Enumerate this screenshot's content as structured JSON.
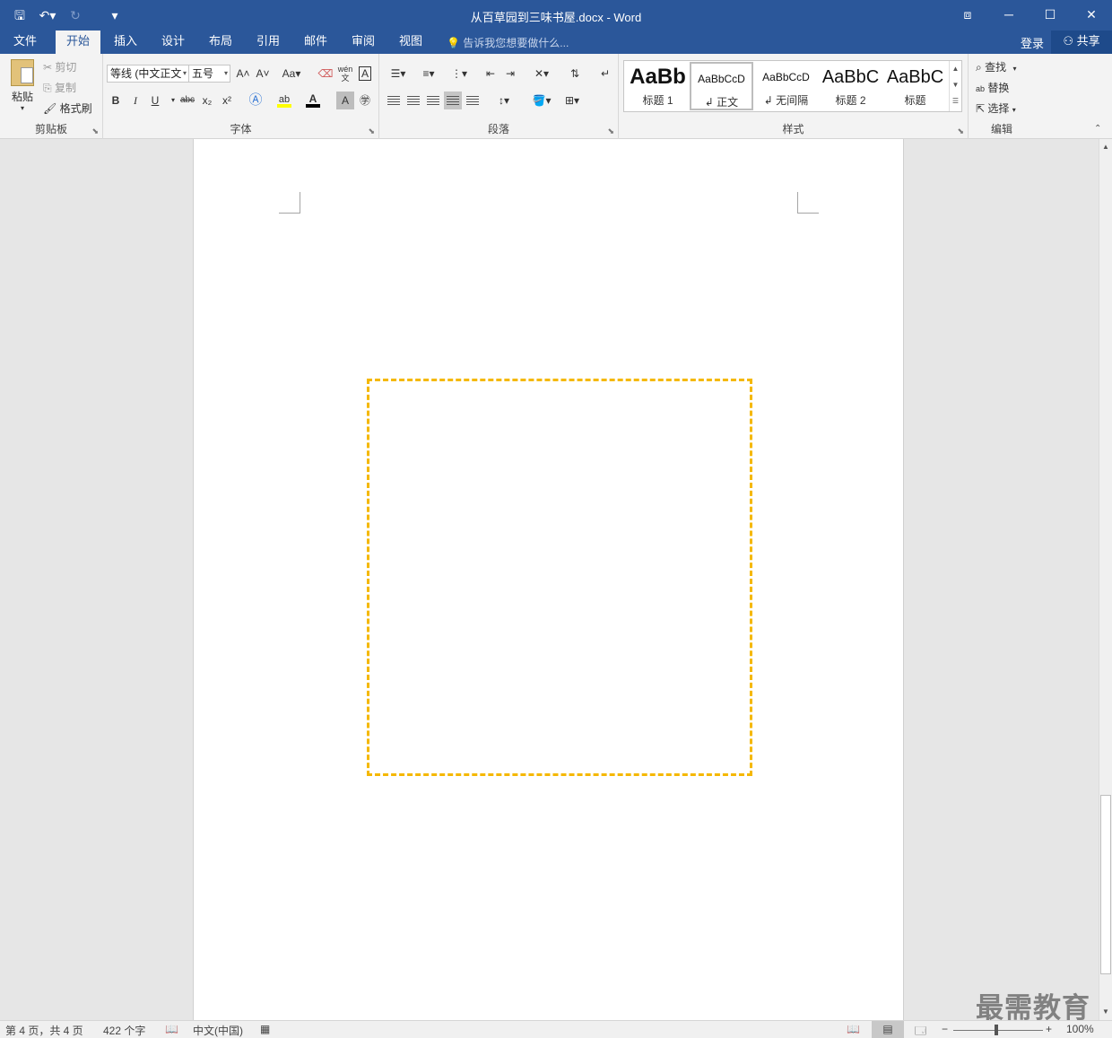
{
  "titlebar": {
    "title": "从百草园到三味书屋.docx - Word",
    "qat": {
      "save": "🖫",
      "undo": "↶▾",
      "redo": "↻",
      "customize": "▾"
    },
    "window_buttons": {
      "ribbon_options": "⧈",
      "minimize": "─",
      "maximize": "☐",
      "close": "✕"
    }
  },
  "tabs": [
    "文件",
    "开始",
    "插入",
    "设计",
    "布局",
    "引用",
    "邮件",
    "审阅",
    "视图"
  ],
  "active_tab": "开始",
  "tell_me": "告诉我您想要做什么...",
  "login": "登录",
  "share": "共享",
  "clipboard": {
    "label": "剪贴板",
    "paste": "粘贴",
    "cut": "剪切",
    "copy": "复制",
    "format_painter": "格式刷"
  },
  "font": {
    "label": "字体",
    "font_name": "等线 (中文正文",
    "font_size": "五号",
    "grow": "A˄",
    "shrink": "A˅",
    "case": "Aa▾",
    "bold": "B",
    "italic": "I",
    "underline": "U",
    "strike": "abc",
    "subscript": "x₂",
    "superscript": "x²"
  },
  "paragraph": {
    "label": "段落"
  },
  "styles": {
    "label": "样式",
    "items": [
      {
        "sample": "AaBb",
        "name": "标题 1"
      },
      {
        "sample": "AaBbCcD",
        "name": "↲ 正文"
      },
      {
        "sample": "AaBbCcD",
        "name": "↲ 无间隔"
      },
      {
        "sample": "AaBbC",
        "name": "标题 2"
      },
      {
        "sample": "AaBbC",
        "name": "标题"
      }
    ],
    "selected_index": 1
  },
  "editing": {
    "label": "编辑",
    "find": "查找",
    "replace": "替换",
    "select": "选择"
  },
  "watermark": "最需教育",
  "status": {
    "page": "第 4 页，共 4 页",
    "words": "422 个字",
    "language": "中文(中国)",
    "zoom": "100%",
    "zoom_level": 1.0
  },
  "colors": {
    "accent": "#2b579a",
    "dashed_box": "#f5b800",
    "highlight": "#ffff00",
    "font_color": "#000000"
  }
}
